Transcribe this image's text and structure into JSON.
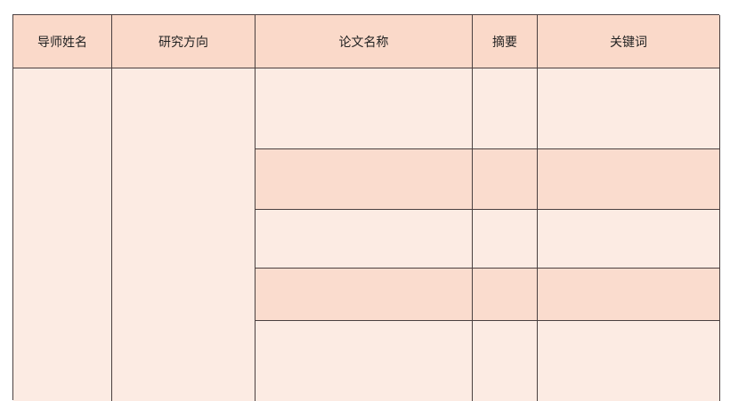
{
  "table": {
    "headers": [
      "导师姓名",
      "研究方向",
      "论文名称",
      "摘要",
      "关键词"
    ],
    "rows": [
      [
        "",
        "",
        ""
      ],
      [
        "",
        "",
        ""
      ],
      [
        "",
        "",
        ""
      ],
      [
        "",
        "",
        ""
      ],
      [
        "",
        "",
        ""
      ]
    ]
  },
  "colors": {
    "header_bg": "#fad9c9",
    "row_light": "#fcebe3",
    "row_dark": "#fadcce",
    "border": "#4a4040"
  }
}
